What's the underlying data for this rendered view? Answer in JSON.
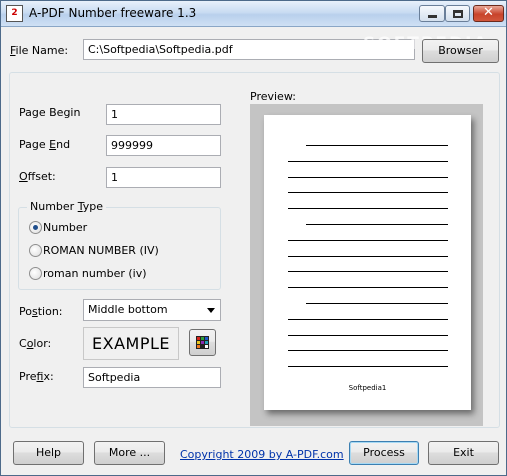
{
  "window": {
    "title": "A-PDF Number freeware 1.3",
    "icon_text": "2",
    "controls": {
      "minimize": "minimize-icon",
      "maximize": "maximize-icon",
      "close": "close-icon"
    },
    "watermark": "SOFTPEDIA"
  },
  "file": {
    "label_prefix": "F",
    "label_rest": "ile Name:",
    "value": "C:\\Softpedia\\Softpedia.pdf",
    "browse_label": "Browser"
  },
  "pages": {
    "begin_label": "Page Begin",
    "begin_value": "1",
    "end_label_a": "Page ",
    "end_label_u": "E",
    "end_label_b": "nd",
    "end_value": "999999",
    "offset_label_u": "O",
    "offset_label_rest": "ffset:",
    "offset_value": "1"
  },
  "number_type": {
    "title_a": "Number ",
    "title_u": "T",
    "title_b": "ype",
    "options": [
      {
        "label": "Number",
        "selected": true
      },
      {
        "label": "ROMAN NUMBER (IV)",
        "selected": false
      },
      {
        "label": "roman number (iv)",
        "selected": false
      }
    ]
  },
  "position": {
    "label_a": "Po",
    "label_u": "s",
    "label_b": "tion:",
    "selected": "Middle bottom"
  },
  "color": {
    "label_a": "C",
    "label_u": "o",
    "label_b": "lor:",
    "example": "EXAMPLE",
    "palette": [
      "#d8261c",
      "#2e9d3a",
      "#1c57c8",
      "#e8c51f",
      "#8a2cb3",
      "#1ea3b8",
      "#f07a1f",
      "#222222",
      "#ffffff"
    ]
  },
  "prefix": {
    "label_a": "Pre",
    "label_u": "f",
    "label_b": "ix:",
    "value": "Softpedia"
  },
  "preview": {
    "label": "Preview:",
    "page_number": "Softpedia1"
  },
  "footer": {
    "help_label": "Help",
    "more_label": "More ...",
    "copyright": "Copyright 2009 by A-PDF.com",
    "process_label": "Process",
    "exit_label": "Exit"
  }
}
